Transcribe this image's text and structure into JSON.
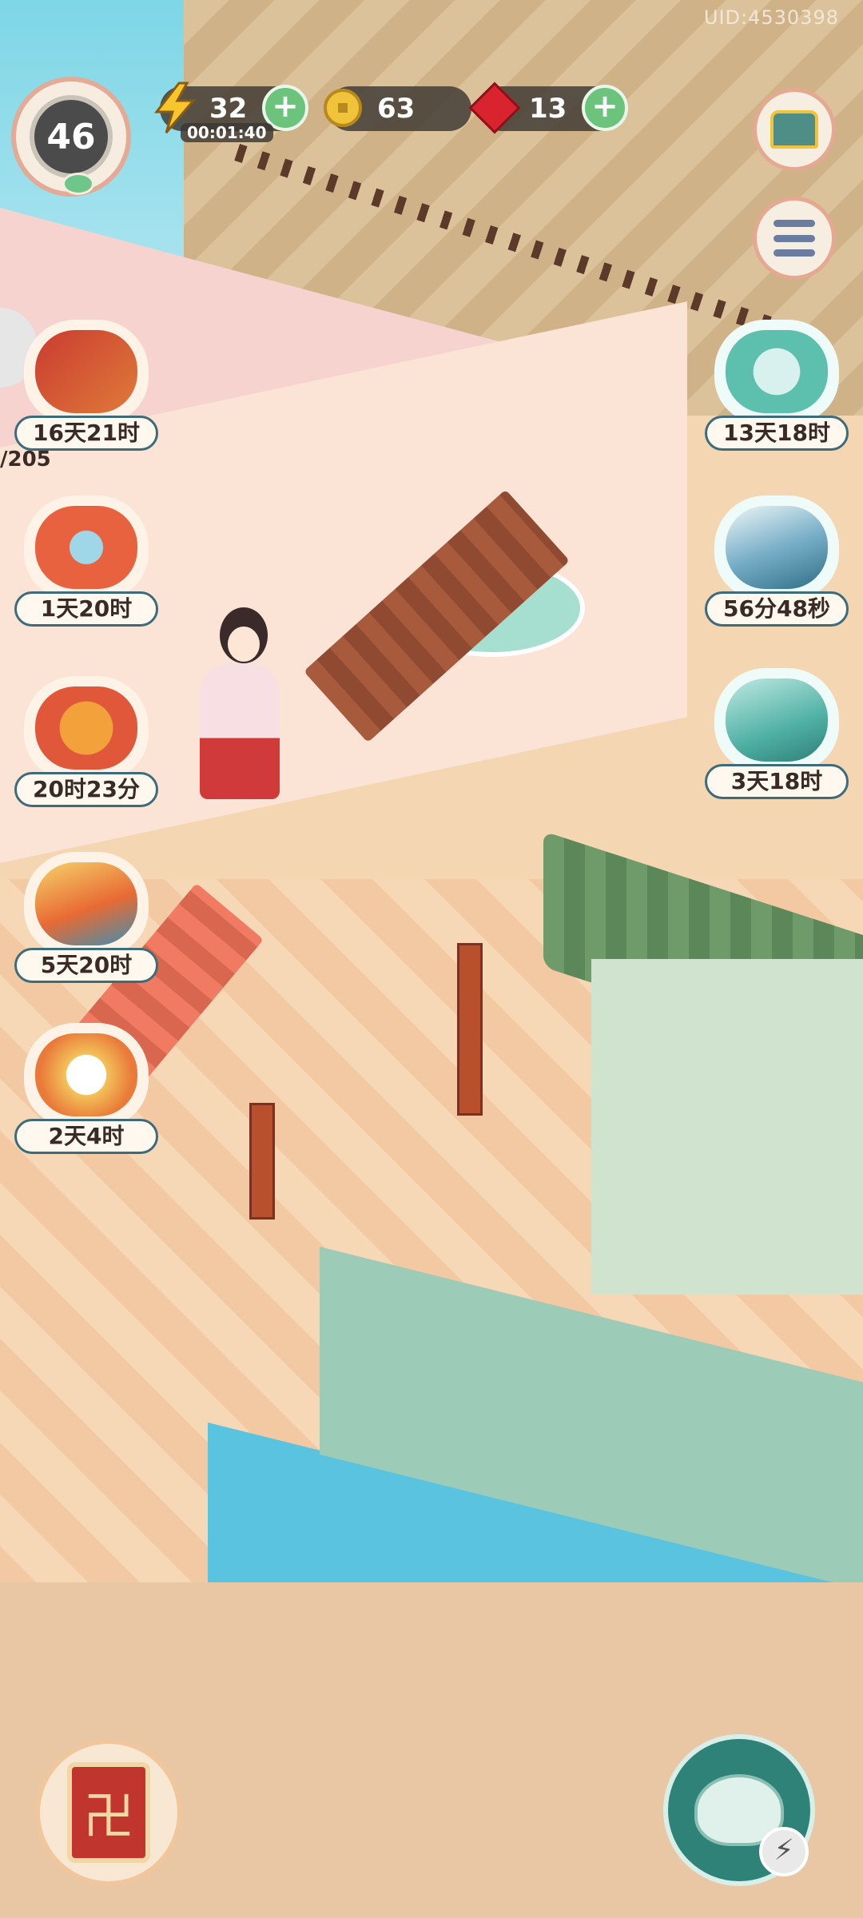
{
  "hud": {
    "uid": "UID:4530398",
    "level": "46",
    "energy": {
      "value": "32",
      "timer": "00:01:40",
      "icon": "lightning-icon"
    },
    "coins": {
      "value": "63",
      "icon": "coin-icon"
    },
    "gems": {
      "value": "13",
      "icon": "ruby-icon"
    },
    "plus_label": "+"
  },
  "producers_left": [
    {
      "time": "16天21时",
      "icon": "scroll-bundle-icon"
    },
    {
      "time": "1天20时",
      "icon": "lion-dance-icon"
    },
    {
      "time": "20时23分",
      "icon": "maple-leaf-icon"
    },
    {
      "time": "5天20时",
      "icon": "phoenix-icon"
    },
    {
      "time": "2天4时",
      "icon": "lucky-cat-icon"
    }
  ],
  "producers_right": [
    {
      "time": "13天18时",
      "icon": "cat-spirit-icon"
    },
    {
      "time": "56分48秒",
      "icon": "crystal-rock-icon"
    },
    {
      "time": "3天18时",
      "icon": "gift-box-cat-icon"
    }
  ],
  "side_count": "/205",
  "bottom": {
    "book_icon": "quest-book-icon",
    "book_glyph": "卍",
    "teapot_icon": "teapot-icon",
    "bolt_glyph": "⚡"
  },
  "colors": {
    "plus_green": "#6cc37c",
    "pill_border": "#3e6b7a",
    "gem_red": "#d9232e",
    "coin_gold": "#f1c33b"
  }
}
